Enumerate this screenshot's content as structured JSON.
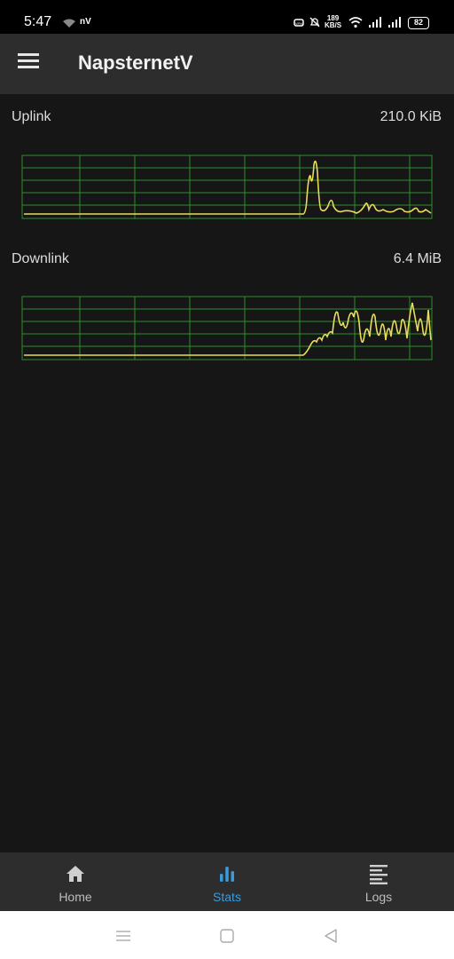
{
  "status_bar": {
    "time": "5:47",
    "carrier_badge": "nV",
    "net_speed_value": "189",
    "net_speed_unit": "KB/S",
    "battery": "82"
  },
  "app_bar": {
    "title": "NapsternetV",
    "menu_icon": "hamburger-menu-icon"
  },
  "stats": {
    "uplink": {
      "label": "Uplink",
      "value": "210.0 KiB",
      "line_color": "#e8dc5a",
      "grid_color": "#2f8f2f"
    },
    "downlink": {
      "label": "Downlink",
      "value": "6.4 MiB",
      "line_color": "#e8dc5a",
      "grid_color": "#2f8f2f"
    }
  },
  "bottom_nav": {
    "items": [
      {
        "label": "Home",
        "icon": "home-icon",
        "active": false
      },
      {
        "label": "Stats",
        "icon": "bar-chart-icon",
        "active": true
      },
      {
        "label": "Logs",
        "icon": "logs-list-icon",
        "active": false
      }
    ],
    "active_color": "#3a9bdc"
  },
  "system_nav": {
    "recents_icon": "recents-icon",
    "home_icon": "system-home-icon",
    "back_icon": "back-icon"
  }
}
